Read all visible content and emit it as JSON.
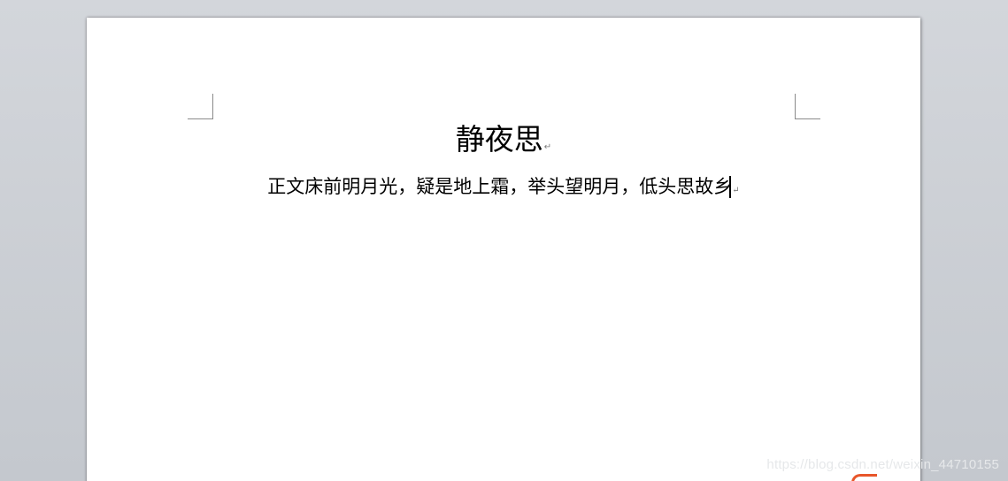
{
  "document": {
    "title": "静夜思",
    "body": "正文床前明月光，疑是地上霜，举头望明月，低头思故乡",
    "paragraph_mark": "↵"
  },
  "watermark": "https://blog.csdn.net/weixin_44710155",
  "colors": {
    "workspace_bg": "#c9cdd3",
    "page_bg": "#ffffff",
    "text": "#000000",
    "corner_marks": "#8a8a8a"
  },
  "icons": {
    "paragraph_mark": "paragraph-mark-icon",
    "text_caret": "text-caret"
  }
}
